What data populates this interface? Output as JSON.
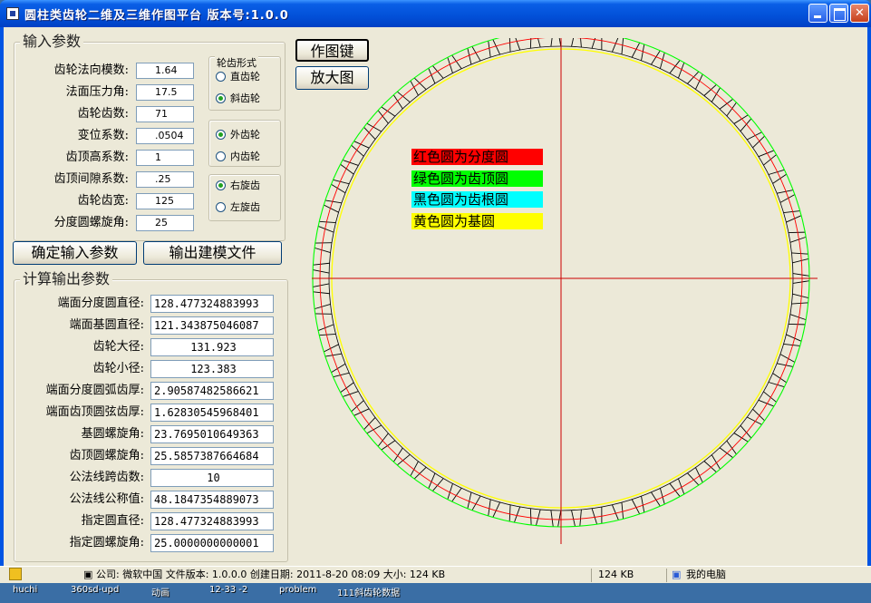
{
  "window": {
    "title": "圆柱类齿轮二维及三维作图平台 版本号:1.0.0"
  },
  "input_group": {
    "title": "输入参数",
    "fields": [
      {
        "label": "齿轮法向模数:",
        "value": "1.64"
      },
      {
        "label": "法面压力角:",
        "value": "17.5"
      },
      {
        "label": "齿轮齿数:",
        "value": "71"
      },
      {
        "label": "变位系数:",
        "value": ".0504"
      },
      {
        "label": "齿顶高系数:",
        "value": "1"
      },
      {
        "label": "齿顶间隙系数:",
        "value": ".25"
      },
      {
        "label": "齿轮齿宽:",
        "value": "125"
      },
      {
        "label": "分度圆螺旋角:",
        "value": "25"
      }
    ],
    "tooth_form": {
      "title": "轮齿形式",
      "options": [
        "直齿轮",
        "斜齿轮"
      ],
      "selected": 1
    },
    "gear_type": {
      "options": [
        "外齿轮",
        "内齿轮"
      ],
      "selected": 0
    },
    "helix_dir": {
      "options": [
        "右旋齿",
        "左旋齿"
      ],
      "selected": 0
    }
  },
  "buttons": {
    "confirm": "确定输入参数",
    "export": "输出建模文件",
    "draw": "作图键",
    "zoom": "放大图"
  },
  "output_group": {
    "title": "计算输出参数",
    "fields": [
      {
        "label": "端面分度圆直径:",
        "value": "128.477324883993"
      },
      {
        "label": "端面基圆直径:",
        "value": "121.343875046087"
      },
      {
        "label": "齿轮大径:",
        "value": "131.923"
      },
      {
        "label": "齿轮小径:",
        "value": "123.383"
      },
      {
        "label": "端面分度圆弧齿厚:",
        "value": "2.90587482586621"
      },
      {
        "label": "端面齿顶圆弦齿厚:",
        "value": "1.62830545968401"
      },
      {
        "label": "基圆螺旋角:",
        "value": "23.7695010649363"
      },
      {
        "label": "齿顶圆螺旋角:",
        "value": "25.5857387664684"
      },
      {
        "label": "公法线跨齿数:",
        "value": "10"
      },
      {
        "label": "公法线公称值:",
        "value": "48.1847354889073"
      },
      {
        "label": "指定圆直径:",
        "value": "128.477324883993"
      },
      {
        "label": "指定圆螺旋角:",
        "value": "25.0000000000001"
      }
    ]
  },
  "legend": [
    {
      "text": "红色圆为分度圆",
      "color": "#ff0000"
    },
    {
      "text": "绿色圆为齿顶圆",
      "color": "#00ff00"
    },
    {
      "text": "黑色圆为齿根圆",
      "color": "#00ffff"
    },
    {
      "text": "黄色圆为基圆",
      "color": "#ffff00"
    }
  ],
  "drawing": {
    "teeth": 71,
    "colors": {
      "pitch": "#ff0000",
      "tip": "#00ff00",
      "root": "#000000",
      "base": "#ffff00",
      "axis": "#cc0000"
    }
  },
  "status_bar": {
    "info": "公司: 微软中国 文件版本: 1.0.0.0 创建日期: 2011-8-20 08:09 大小: 124 KB",
    "size": "124 KB",
    "computer": "我的电脑"
  },
  "desktop_icons": [
    "huchi",
    "360sd-upd",
    "动画",
    "12-33 -2",
    "problem",
    "111斜齿轮数据"
  ]
}
